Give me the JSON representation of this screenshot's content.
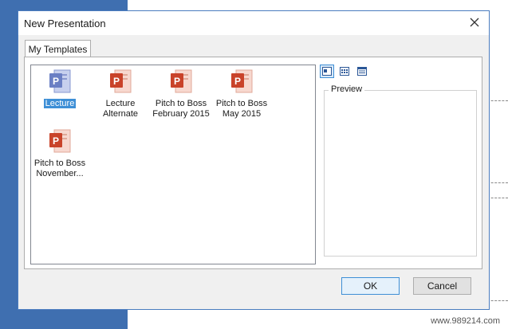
{
  "dialog": {
    "title": "New Presentation",
    "tab_label": "My Templates",
    "preview_label": "Preview",
    "ok_label": "OK",
    "cancel_label": "Cancel"
  },
  "templates": [
    {
      "line1": "Lecture",
      "line2": "",
      "selected": true
    },
    {
      "line1": "Lecture",
      "line2": "Alternate"
    },
    {
      "line1": "Pitch to Boss",
      "line2": "February 2015"
    },
    {
      "line1": "Pitch to Boss",
      "line2": "May 2015"
    },
    {
      "line1": "Pitch to Boss",
      "line2": "November..."
    }
  ],
  "views": [
    "large-icons-view",
    "list-view",
    "details-view"
  ],
  "watermark": "www.989214.com",
  "colors": {
    "accent": "#3e8fd6",
    "ppt_red": "#c9432a",
    "ppt_doc_bg": "#f7d8cf",
    "selected_icon": "#6a7fc4"
  }
}
